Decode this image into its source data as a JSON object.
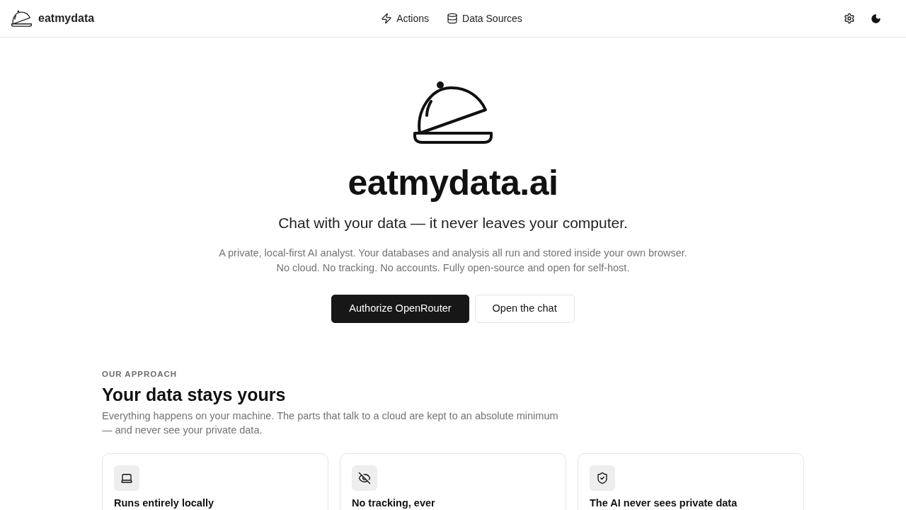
{
  "header": {
    "brand": "eatmydata",
    "nav": [
      {
        "label": "Actions"
      },
      {
        "label": "Data Sources"
      }
    ]
  },
  "hero": {
    "title": "eatmydata.ai",
    "tagline": "Chat with your data — it never leaves your computer.",
    "description": [
      "A private, local-first AI analyst. Your databases and analysis all run and stored inside your own browser.",
      "No cloud. No tracking. No accounts. Fully open-source and open for self-host."
    ],
    "buttons": [
      {
        "label": "Authorize OpenRouter",
        "kind": "primary"
      },
      {
        "label": "Open the chat",
        "kind": "secondary"
      }
    ]
  },
  "approach": {
    "eyebrow": "OUR APPROACH",
    "heading": "Your data stays yours",
    "description": "Everything happens on your machine. The parts that talk to a cloud are kept to an absolute minimum — and never see your private data.",
    "cards": [
      {
        "title": "Runs entirely locally"
      },
      {
        "title": "No tracking, ever"
      },
      {
        "title": "The AI never sees private data"
      }
    ]
  }
}
